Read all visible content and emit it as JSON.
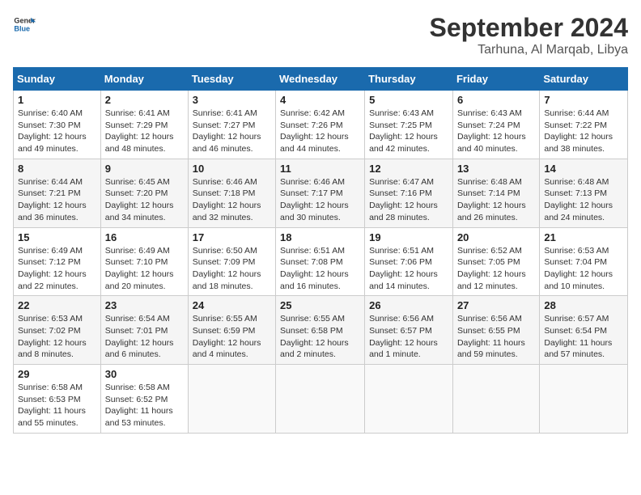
{
  "header": {
    "logo_line1": "General",
    "logo_line2": "Blue",
    "month": "September 2024",
    "location": "Tarhuna, Al Marqab, Libya"
  },
  "weekdays": [
    "Sunday",
    "Monday",
    "Tuesday",
    "Wednesday",
    "Thursday",
    "Friday",
    "Saturday"
  ],
  "weeks": [
    [
      {
        "day": "1",
        "info": "Sunrise: 6:40 AM\nSunset: 7:30 PM\nDaylight: 12 hours\nand 49 minutes."
      },
      {
        "day": "2",
        "info": "Sunrise: 6:41 AM\nSunset: 7:29 PM\nDaylight: 12 hours\nand 48 minutes."
      },
      {
        "day": "3",
        "info": "Sunrise: 6:41 AM\nSunset: 7:27 PM\nDaylight: 12 hours\nand 46 minutes."
      },
      {
        "day": "4",
        "info": "Sunrise: 6:42 AM\nSunset: 7:26 PM\nDaylight: 12 hours\nand 44 minutes."
      },
      {
        "day": "5",
        "info": "Sunrise: 6:43 AM\nSunset: 7:25 PM\nDaylight: 12 hours\nand 42 minutes."
      },
      {
        "day": "6",
        "info": "Sunrise: 6:43 AM\nSunset: 7:24 PM\nDaylight: 12 hours\nand 40 minutes."
      },
      {
        "day": "7",
        "info": "Sunrise: 6:44 AM\nSunset: 7:22 PM\nDaylight: 12 hours\nand 38 minutes."
      }
    ],
    [
      {
        "day": "8",
        "info": "Sunrise: 6:44 AM\nSunset: 7:21 PM\nDaylight: 12 hours\nand 36 minutes."
      },
      {
        "day": "9",
        "info": "Sunrise: 6:45 AM\nSunset: 7:20 PM\nDaylight: 12 hours\nand 34 minutes."
      },
      {
        "day": "10",
        "info": "Sunrise: 6:46 AM\nSunset: 7:18 PM\nDaylight: 12 hours\nand 32 minutes."
      },
      {
        "day": "11",
        "info": "Sunrise: 6:46 AM\nSunset: 7:17 PM\nDaylight: 12 hours\nand 30 minutes."
      },
      {
        "day": "12",
        "info": "Sunrise: 6:47 AM\nSunset: 7:16 PM\nDaylight: 12 hours\nand 28 minutes."
      },
      {
        "day": "13",
        "info": "Sunrise: 6:48 AM\nSunset: 7:14 PM\nDaylight: 12 hours\nand 26 minutes."
      },
      {
        "day": "14",
        "info": "Sunrise: 6:48 AM\nSunset: 7:13 PM\nDaylight: 12 hours\nand 24 minutes."
      }
    ],
    [
      {
        "day": "15",
        "info": "Sunrise: 6:49 AM\nSunset: 7:12 PM\nDaylight: 12 hours\nand 22 minutes."
      },
      {
        "day": "16",
        "info": "Sunrise: 6:49 AM\nSunset: 7:10 PM\nDaylight: 12 hours\nand 20 minutes."
      },
      {
        "day": "17",
        "info": "Sunrise: 6:50 AM\nSunset: 7:09 PM\nDaylight: 12 hours\nand 18 minutes."
      },
      {
        "day": "18",
        "info": "Sunrise: 6:51 AM\nSunset: 7:08 PM\nDaylight: 12 hours\nand 16 minutes."
      },
      {
        "day": "19",
        "info": "Sunrise: 6:51 AM\nSunset: 7:06 PM\nDaylight: 12 hours\nand 14 minutes."
      },
      {
        "day": "20",
        "info": "Sunrise: 6:52 AM\nSunset: 7:05 PM\nDaylight: 12 hours\nand 12 minutes."
      },
      {
        "day": "21",
        "info": "Sunrise: 6:53 AM\nSunset: 7:04 PM\nDaylight: 12 hours\nand 10 minutes."
      }
    ],
    [
      {
        "day": "22",
        "info": "Sunrise: 6:53 AM\nSunset: 7:02 PM\nDaylight: 12 hours\nand 8 minutes."
      },
      {
        "day": "23",
        "info": "Sunrise: 6:54 AM\nSunset: 7:01 PM\nDaylight: 12 hours\nand 6 minutes."
      },
      {
        "day": "24",
        "info": "Sunrise: 6:55 AM\nSunset: 6:59 PM\nDaylight: 12 hours\nand 4 minutes."
      },
      {
        "day": "25",
        "info": "Sunrise: 6:55 AM\nSunset: 6:58 PM\nDaylight: 12 hours\nand 2 minutes."
      },
      {
        "day": "26",
        "info": "Sunrise: 6:56 AM\nSunset: 6:57 PM\nDaylight: 12 hours\nand 1 minute."
      },
      {
        "day": "27",
        "info": "Sunrise: 6:56 AM\nSunset: 6:55 PM\nDaylight: 11 hours\nand 59 minutes."
      },
      {
        "day": "28",
        "info": "Sunrise: 6:57 AM\nSunset: 6:54 PM\nDaylight: 11 hours\nand 57 minutes."
      }
    ],
    [
      {
        "day": "29",
        "info": "Sunrise: 6:58 AM\nSunset: 6:53 PM\nDaylight: 11 hours\nand 55 minutes."
      },
      {
        "day": "30",
        "info": "Sunrise: 6:58 AM\nSunset: 6:52 PM\nDaylight: 11 hours\nand 53 minutes."
      },
      {
        "day": "",
        "info": ""
      },
      {
        "day": "",
        "info": ""
      },
      {
        "day": "",
        "info": ""
      },
      {
        "day": "",
        "info": ""
      },
      {
        "day": "",
        "info": ""
      }
    ]
  ]
}
